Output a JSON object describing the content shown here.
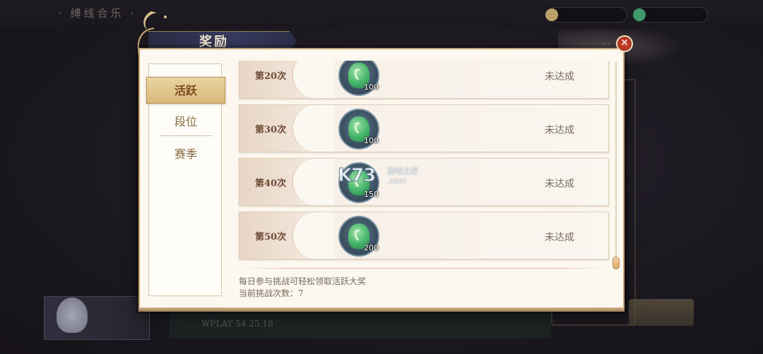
{
  "background": {
    "top_title": "· 缚线合乐 ·",
    "bottom_text": "WPLAY  54 25.18"
  },
  "dialog": {
    "title": "奖励",
    "close_label": "✕",
    "corner_dots": "···"
  },
  "tabs": [
    {
      "label": "活跃",
      "active": true
    },
    {
      "label": "段位",
      "active": false
    },
    {
      "label": "赛季",
      "active": false
    }
  ],
  "rewards": [
    {
      "label": "第20次",
      "count": "100",
      "status": "未达成",
      "icon": "green-gem-coin-icon"
    },
    {
      "label": "第30次",
      "count": "100",
      "status": "未达成",
      "icon": "green-gem-coin-icon"
    },
    {
      "label": "第40次",
      "count": "150",
      "status": "未达成",
      "icon": "green-gem-coin-icon"
    },
    {
      "label": "第50次",
      "count": "200",
      "status": "未达成",
      "icon": "green-gem-coin-icon"
    }
  ],
  "footer": {
    "hint": "每日参与挑战可轻松领取活跃大奖",
    "current": "当前挑战次数：7"
  },
  "watermark": {
    "logo": "K73",
    "line1": "游戏之家",
    "line2": ".com"
  },
  "colors": {
    "panel_bg": "#fcf7ef",
    "tab_active": "#d8b878",
    "close_red": "#c0392b",
    "title_banner": "#2f3250"
  }
}
